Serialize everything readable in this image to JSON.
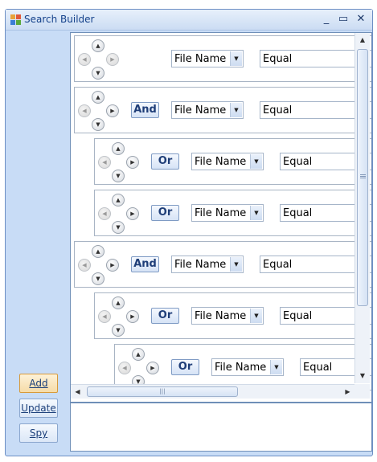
{
  "window": {
    "title": "Search Builder",
    "icon": "app-grid-icon",
    "controls": {
      "minimize": "_",
      "maximize": "▭",
      "close": "✕"
    }
  },
  "sidebar": {
    "add_label": "Add",
    "update_label": "Update",
    "spy_label": "Spy"
  },
  "rows": [
    {
      "operator": "",
      "field": "File Name",
      "comparison": "Equal",
      "indent": 0
    },
    {
      "operator": "And",
      "field": "File Name",
      "comparison": "Equal",
      "indent": 0
    },
    {
      "operator": "Or",
      "field": "File Name",
      "comparison": "Equal",
      "indent": 1
    },
    {
      "operator": "Or",
      "field": "File Name",
      "comparison": "Equal",
      "indent": 1
    },
    {
      "operator": "And",
      "field": "File Name",
      "comparison": "Equal",
      "indent": 0
    },
    {
      "operator": "Or",
      "field": "File Name",
      "comparison": "Equal",
      "indent": 1
    },
    {
      "operator": "Or",
      "field": "File Name",
      "comparison": "Equal",
      "indent": 2
    }
  ],
  "nav_icons": [
    "arrow-up-icon",
    "arrow-left-icon",
    "arrow-right-icon",
    "arrow-down-icon"
  ],
  "colors": {
    "accent": "#15428b",
    "panel": "#c8dcf6",
    "focus": "#d89a3a"
  }
}
